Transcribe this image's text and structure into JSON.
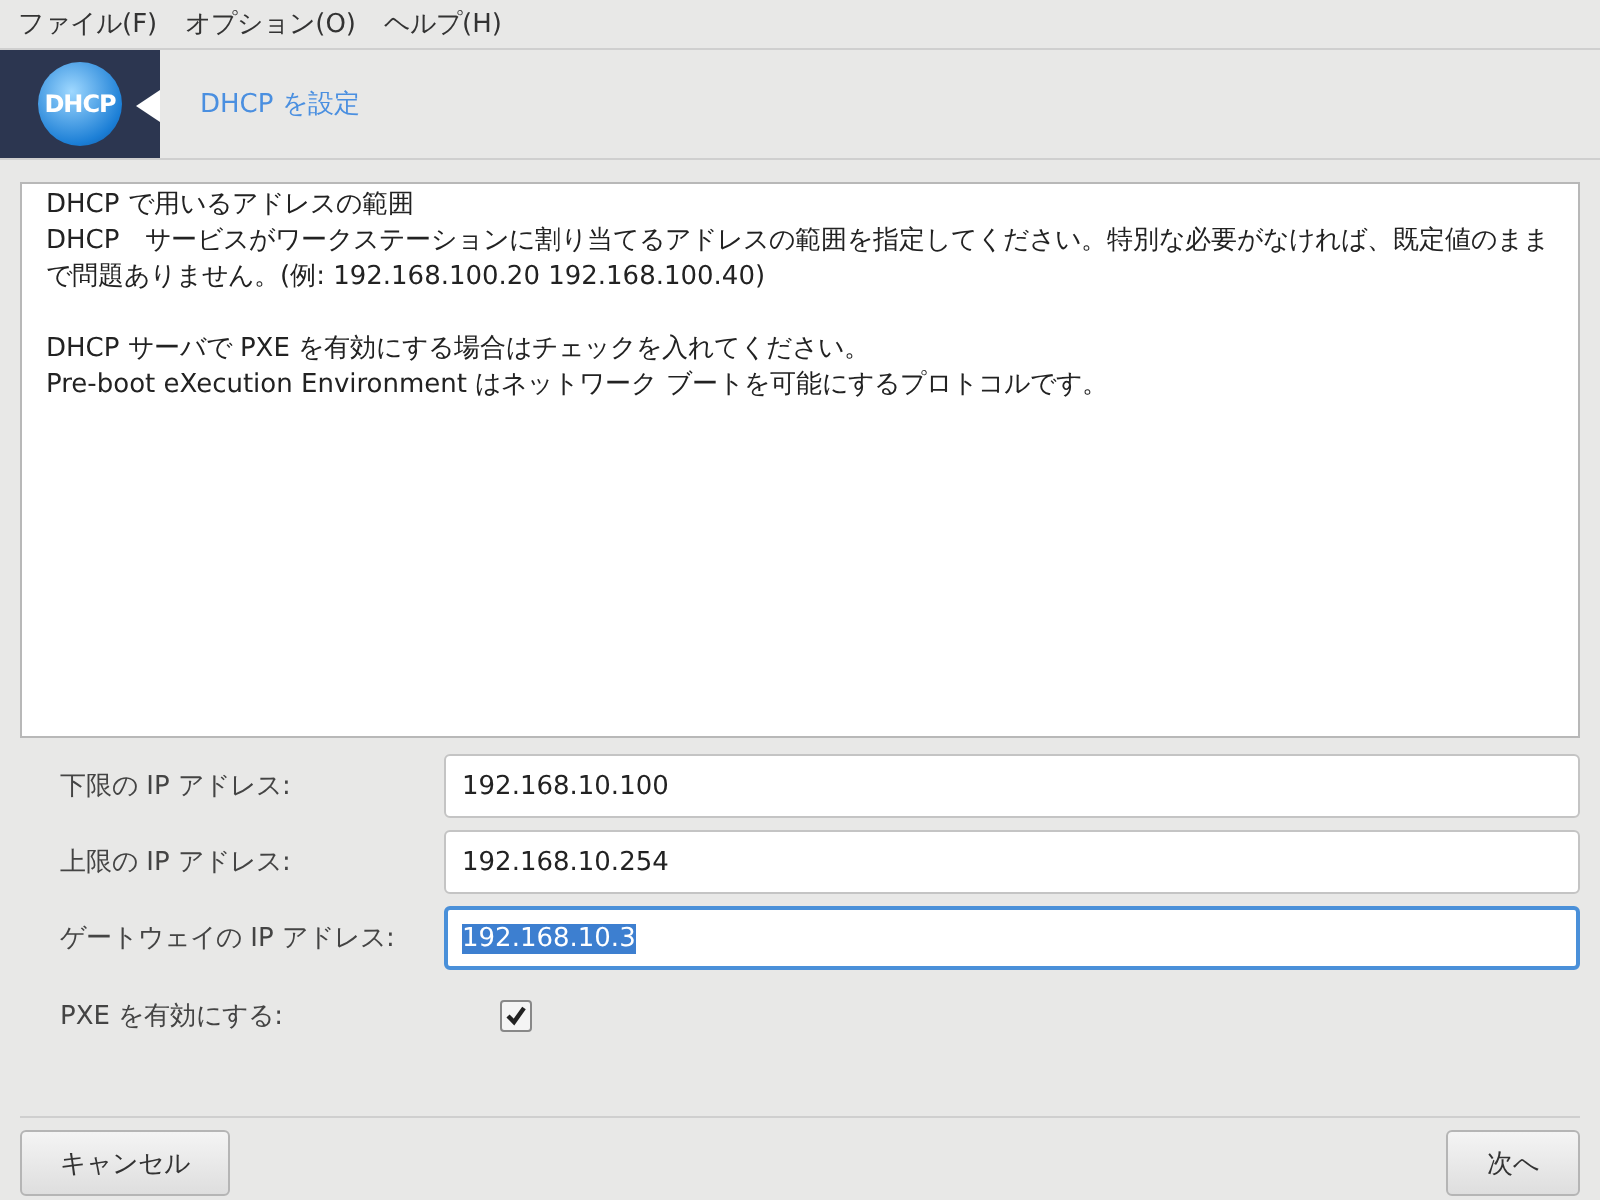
{
  "menu": [
    "ファイル(F)",
    "オプション(O)",
    "ヘルプ(H)"
  ],
  "header": {
    "logo": "DHCP",
    "title": "DHCP を設定"
  },
  "description": [
    [
      "DHCP で用いるアドレスの範囲",
      "DHCP　サービスがワークステーションに割り当てるアドレスの範囲を指定してください。特別な必要がなければ、既定値のままで問題ありません。(例: 192.168.100.20 192.168.100.40)"
    ],
    [
      "DHCP サーバで PXE を有効にする場合はチェックを入れてください。",
      "Pre-boot eXecution Environment はネットワーク ブートを可能にするプロトコルです。"
    ]
  ],
  "fields": [
    {
      "kind": "text",
      "label": "下限の IP アドレス:",
      "value": "192.168.10.100",
      "focused": false
    },
    {
      "kind": "text",
      "label": "上限の IP アドレス:",
      "value": "192.168.10.254",
      "focused": false
    },
    {
      "kind": "text",
      "label": "ゲートウェイの IP アドレス:",
      "value": "192.168.10.3",
      "focused": true
    },
    {
      "kind": "checkbox",
      "label": "PXE を有効にする:",
      "checked": true
    }
  ],
  "buttons": {
    "cancel": "キャンセル",
    "next": "次へ"
  }
}
